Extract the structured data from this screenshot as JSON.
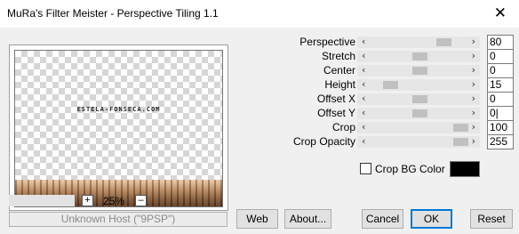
{
  "window": {
    "title": "MuRa's Filter Meister - Perspective Tiling 1.1"
  },
  "preview": {
    "watermark": "ESTELA-FONSECA.COM"
  },
  "zoom": {
    "plus": "+",
    "value": "25%",
    "minus": "–"
  },
  "host": {
    "text": "Unknown Host (\"9PSP\")"
  },
  "params": [
    {
      "label": "Perspective",
      "value": "80",
      "level": 0.8
    },
    {
      "label": "Stretch",
      "value": "0",
      "level": 0.5
    },
    {
      "label": "Center",
      "value": "0",
      "level": 0.5
    },
    {
      "label": "Height",
      "value": "15",
      "level": 0.15
    },
    {
      "label": "Offset X",
      "value": "0",
      "level": 0.5
    },
    {
      "label": "Offset Y",
      "value": "0|",
      "level": 0.5
    },
    {
      "label": "Crop",
      "value": "100",
      "level": 1.0
    },
    {
      "label": "Crop Opacity",
      "value": "255",
      "level": 1.0
    }
  ],
  "crop_bg": {
    "label": "Crop BG Color",
    "checked": false,
    "color": "#000000"
  },
  "buttons": {
    "web": "Web",
    "about": "About...",
    "cancel": "Cancel",
    "ok": "OK",
    "reset": "Reset"
  }
}
